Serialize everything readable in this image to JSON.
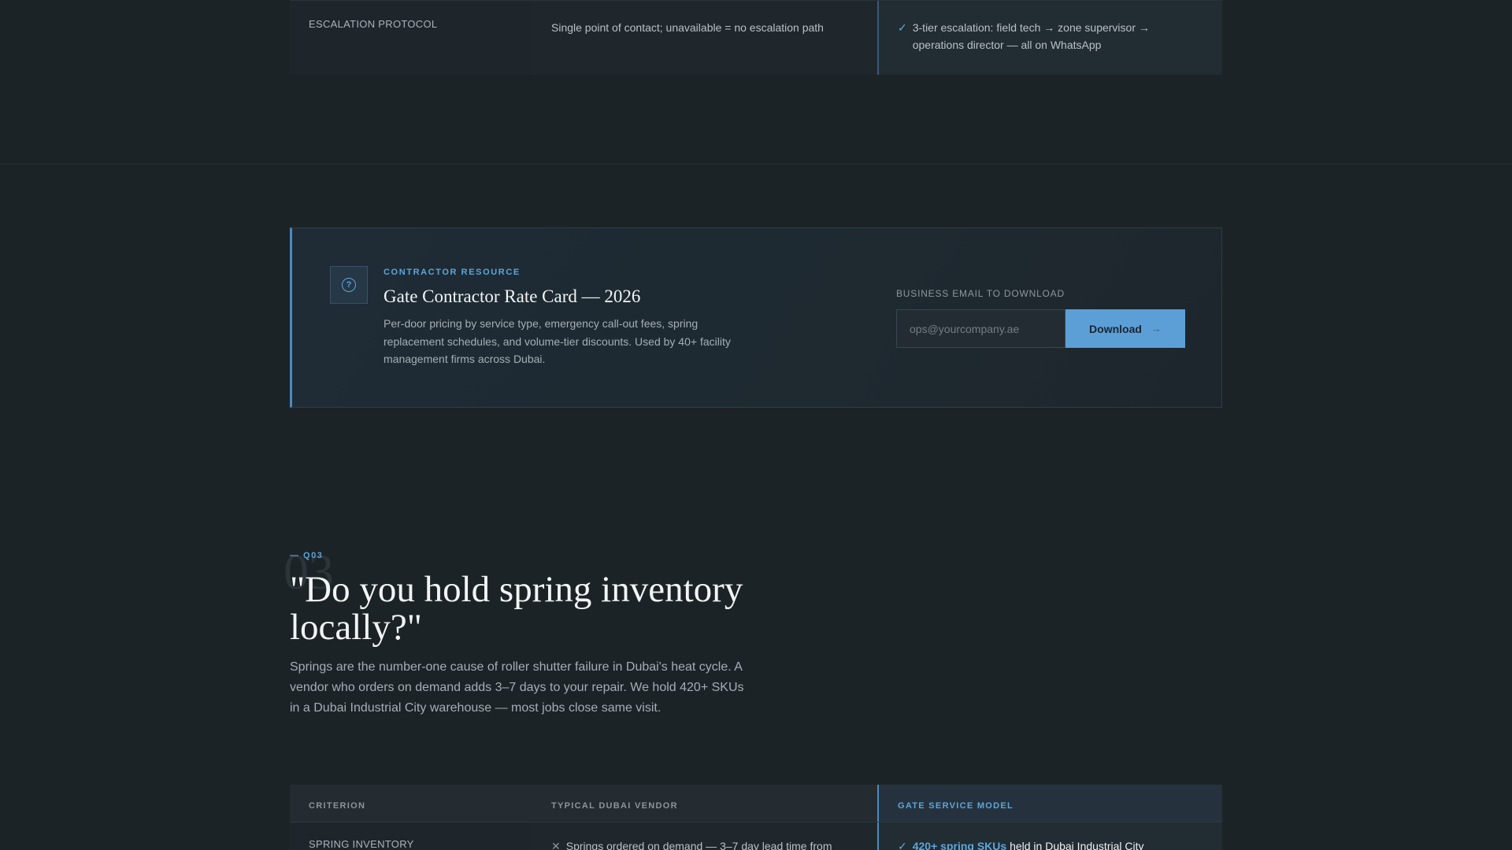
{
  "top_row": {
    "criterion": "ESCALATION PROTOCOL",
    "vendor": "Single point of contact; unavailable = no escalation path",
    "gate": "3-tier escalation: field tech → zone supervisor → operations director — all on WhatsApp"
  },
  "resource_card": {
    "eyebrow": "CONTRACTOR RESOURCE",
    "title": "Gate Contractor Rate Card — 2026",
    "description": "Per-door pricing by service type, emergency call-out fees, spring replacement schedules, and volume-tier discounts. Used by 40+ facility management firms across Dubai.",
    "email_label": "BUSINESS EMAIL TO DOWNLOAD",
    "email_placeholder": "ops@yourcompany.ae",
    "button_label": "Download",
    "icon": "question-circle-icon"
  },
  "question": {
    "big_number": "03",
    "tag": "— Q03",
    "title": "\"Do you hold spring inventory locally?\"",
    "description": "Springs are the number-one cause of roller shutter failure in Dubai's heat cycle. A vendor who orders on demand adds 3–7 days to your repair. We hold 420+ SKUs in a Dubai Industrial City warehouse — most jobs close same visit."
  },
  "table": {
    "headers": [
      "CRITERION",
      "TYPICAL DUBAI VENDOR",
      "GATE SERVICE MODEL"
    ],
    "row": {
      "criterion": "SPRING INVENTORY",
      "vendor": "Springs ordered on demand — 3–7 day lead time from",
      "gate_highlight": "420+ spring SKUs",
      "gate_rest": "held in Dubai Industrial City"
    }
  },
  "colors": {
    "background": "#1c2327",
    "accent": "#5aa6dc",
    "button": "#5b9fd6"
  }
}
